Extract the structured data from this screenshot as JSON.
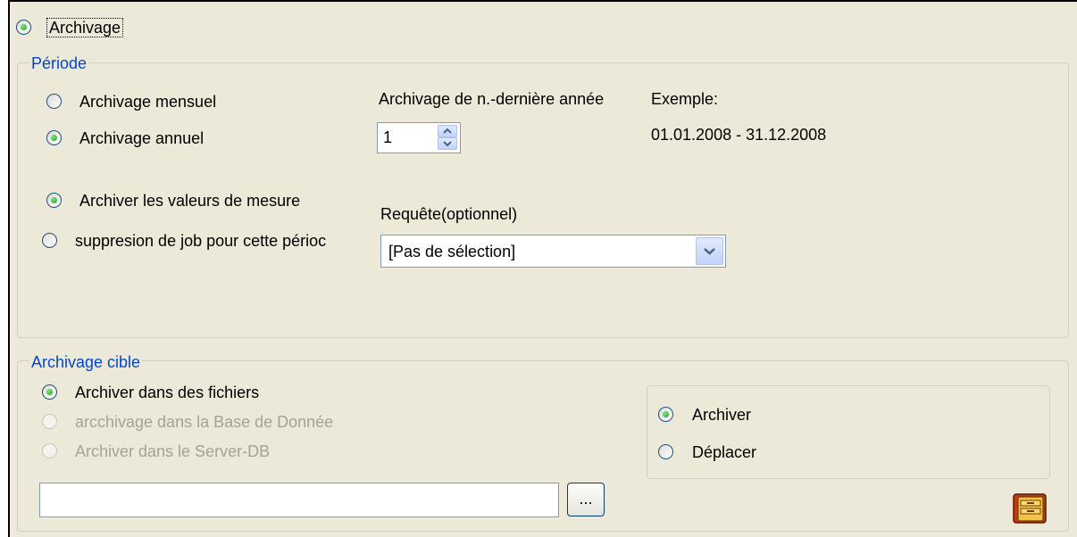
{
  "archivage_radio": {
    "label": "Archivage",
    "checked": true
  },
  "periode": {
    "legend": "Période",
    "options": [
      {
        "label": "Archivage mensuel",
        "checked": false
      },
      {
        "label": "Archivage annuel",
        "checked": true
      }
    ],
    "year_label": "Archivage de n.-dernière année",
    "year_value": "1",
    "example_label": "Exemple:",
    "example_value": "01.01.2008 - 31.12.2008",
    "actions": [
      {
        "label": "Archiver les valeurs de mesure",
        "checked": true
      },
      {
        "label": "suppresion de job pour cette périoc",
        "checked": false
      }
    ],
    "query_label": "Requête(optionnel)",
    "query_value": "[Pas de sélection]"
  },
  "cible": {
    "legend": "Archivage cible",
    "options": [
      {
        "label": "Archiver dans des fichiers",
        "checked": true,
        "enabled": true
      },
      {
        "label": "arcchivage dans la Base de Donnée",
        "checked": false,
        "enabled": false
      },
      {
        "label": "Archiver dans le Server-DB",
        "checked": false,
        "enabled": false
      }
    ],
    "mode_options": [
      {
        "label": "Archiver",
        "checked": true
      },
      {
        "label": "Déplacer",
        "checked": false
      }
    ],
    "path_value": "",
    "browse_label": "...",
    "archive_icon": "archive-cabinet-icon"
  }
}
